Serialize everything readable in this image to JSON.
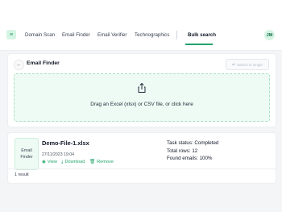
{
  "header": {
    "logo_label": "≡",
    "nav": [
      {
        "label": "Domain Scan"
      },
      {
        "label": "Email Finder"
      },
      {
        "label": "Email Verifier"
      },
      {
        "label": "Technographics"
      },
      {
        "label": "Bulk search"
      }
    ],
    "active_tab": "Bulk search",
    "avatar_initials": "JM"
  },
  "finder": {
    "title": "Email Finder",
    "switch_label": "Switch to single",
    "dropzone_text": "Drag an Excel (xlsx) or CSV file, or click here"
  },
  "task": {
    "badge_label": "Email Finder",
    "file_name": "Demo-File-1.xlsx",
    "date": "27/11/2023 19:04",
    "actions": {
      "view": "View",
      "download": "Download",
      "remove": "Remove"
    },
    "status_label": "Task status:",
    "status_value": "Completed",
    "total_rows_label": "Total rows:",
    "total_rows_value": "12",
    "found_label": "Found emails:",
    "found_value": "100%"
  },
  "results_count": "1 result",
  "colors": {
    "accent": "#22a36b",
    "dropzone_bg": "#eefbf4",
    "page_bg": "#f4f5f7"
  }
}
